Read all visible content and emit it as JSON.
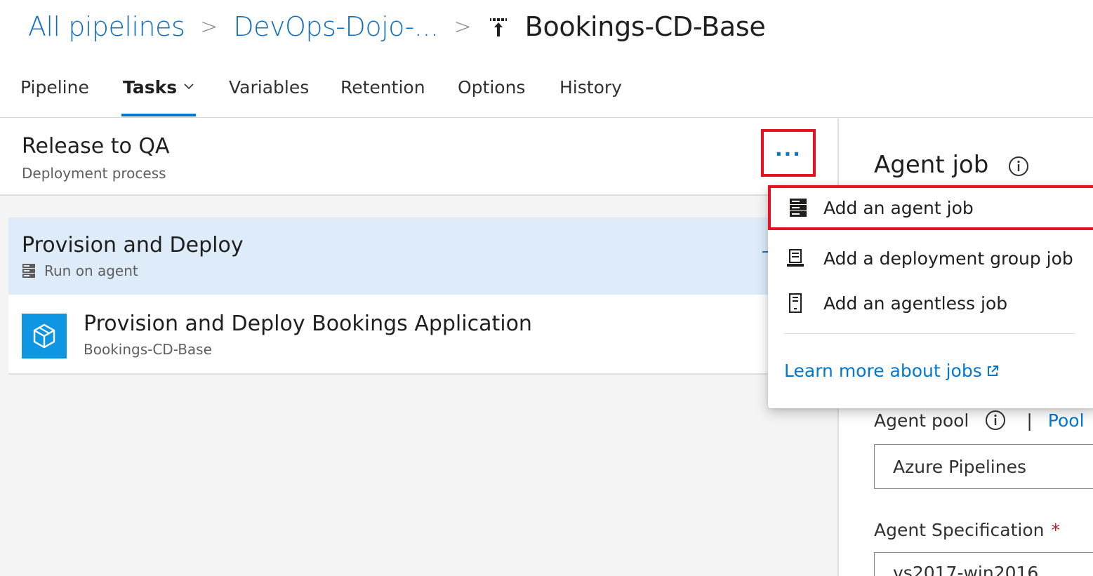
{
  "breadcrumb": {
    "root": "All pipelines",
    "folder": "DevOps-Dojo-...",
    "current": "Bookings-CD-Base",
    "current_icon": "release-pipeline-icon"
  },
  "tabs": [
    {
      "label": "Pipeline"
    },
    {
      "label": "Tasks"
    },
    {
      "label": "Variables"
    },
    {
      "label": "Retention"
    },
    {
      "label": "Options"
    },
    {
      "label": "History"
    }
  ],
  "active_tab": "Tasks",
  "stage": {
    "title": "Release to QA",
    "subtitle": "Deployment process",
    "more_label": "..."
  },
  "job": {
    "title": "Provision and Deploy",
    "subtitle": "Run on agent"
  },
  "task": {
    "title": "Provision and Deploy Bookings Application",
    "subtitle": "Bookings-CD-Base"
  },
  "menu": {
    "items": [
      {
        "label": "Add an agent job",
        "icon": "agent-job-icon"
      },
      {
        "label": "Add a deployment group job",
        "icon": "deployment-group-icon"
      },
      {
        "label": "Add an agentless job",
        "icon": "agentless-job-icon"
      }
    ],
    "learn_more": "Learn more about jobs"
  },
  "panel": {
    "title": "Agent job",
    "pool_label": "Agent pool",
    "pool_separator": "|",
    "pool_link": "Pool",
    "pool_value": "Azure Pipelines",
    "spec_label": "Agent Specification",
    "spec_required": "*",
    "spec_value": "vs2017-win2016"
  },
  "colors": {
    "accent": "#0078d4",
    "highlight_border": "#e81123",
    "selected_row": "#deecf9",
    "task_icon_bg": "#0e96e3"
  }
}
